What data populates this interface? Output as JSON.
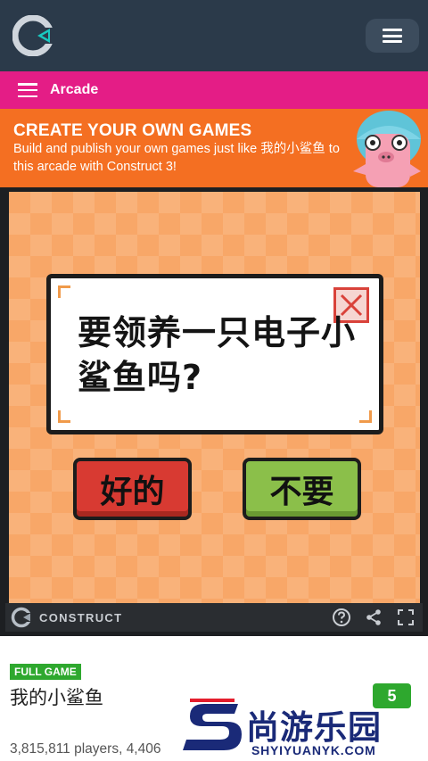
{
  "header": {
    "logo_icon": "construct-logo-icon",
    "menu_icon": "hamburger-icon"
  },
  "arcade": {
    "label": "Arcade",
    "menu_icon": "hamburger-icon",
    "color": "#e41d86"
  },
  "promo": {
    "title": "CREATE YOUR OWN GAMES",
    "text": "Build and publish your own games just like 我的小鲨鱼 to this arcade with Construct 3!",
    "color": "#f46f22"
  },
  "game": {
    "dialog_text": "要领养一只电子小鲨鱼吗?",
    "yes_label": "好的",
    "no_label": "不要",
    "close_icon": "close-x-icon",
    "bar": {
      "brand": "CONSTRUCT",
      "icons": [
        "help-icon",
        "share-icon",
        "fullscreen-icon"
      ]
    }
  },
  "info": {
    "badge": "FULL GAME",
    "title": "我的小鲨鱼",
    "chip": "5",
    "stats": "3,815,811 players, 4,406"
  },
  "watermark": {
    "text": "尚游乐园",
    "sub": "SHYIYUANYK.COM"
  }
}
